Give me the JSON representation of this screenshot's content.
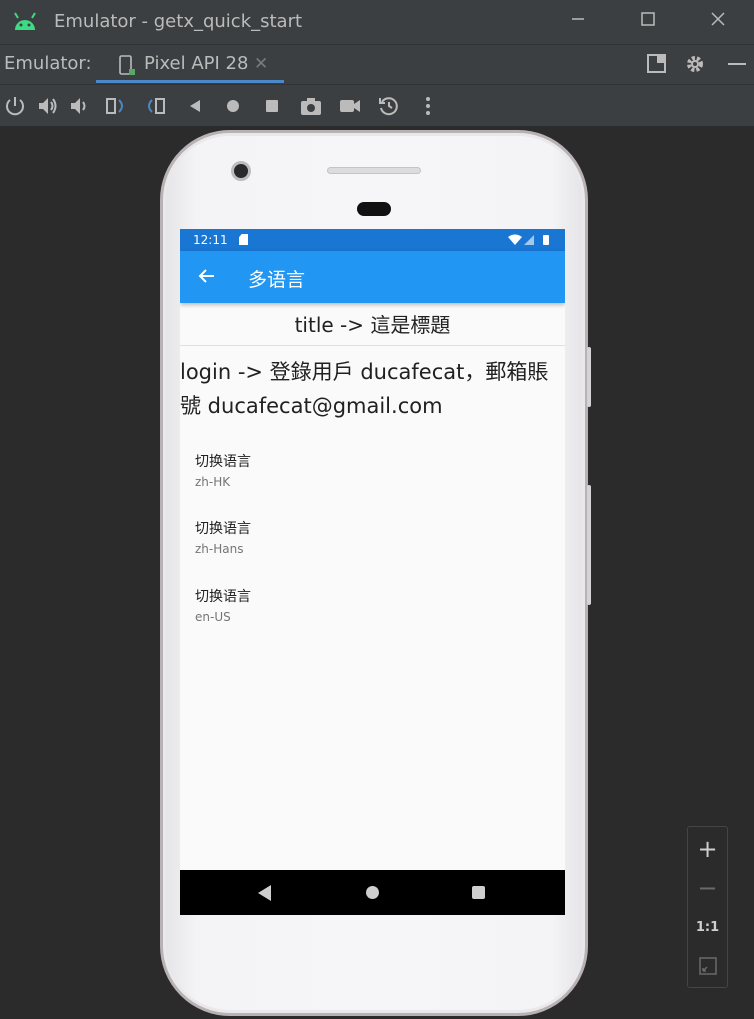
{
  "window": {
    "title": "Emulator - getx_quick_start"
  },
  "tabbar": {
    "label": "Emulator:",
    "tab_label": "Pixel API 28"
  },
  "toolbar": {
    "buttons": [
      "power-icon",
      "volume-up-icon",
      "volume-down-icon",
      "rotate-left-icon",
      "rotate-right-icon",
      "back-icon",
      "home-icon",
      "overview-icon",
      "screenshot-icon",
      "screen-record-icon",
      "snapshot-icon",
      "more-icon"
    ]
  },
  "device": {
    "status_time": "12:11",
    "appbar_title": "多语言",
    "content_title": "title -> 這是標題",
    "content_login": "login -> 登錄用戶 ducafecat，郵箱賬號 ducafecat@gmail.com",
    "languages": [
      {
        "title": "切换语言",
        "locale": "zh-HK"
      },
      {
        "title": "切换语言",
        "locale": "zh-Hans"
      },
      {
        "title": "切换语言",
        "locale": "en-US"
      }
    ]
  },
  "zoom": {
    "zoom_in": "+",
    "zoom_out": "−",
    "actual_size": "1:1"
  },
  "colors": {
    "statusbar": "#1976d2",
    "appbar": "#2196f3",
    "ide_background": "#2b2b2b",
    "tab_underline": "#4a88c7"
  }
}
